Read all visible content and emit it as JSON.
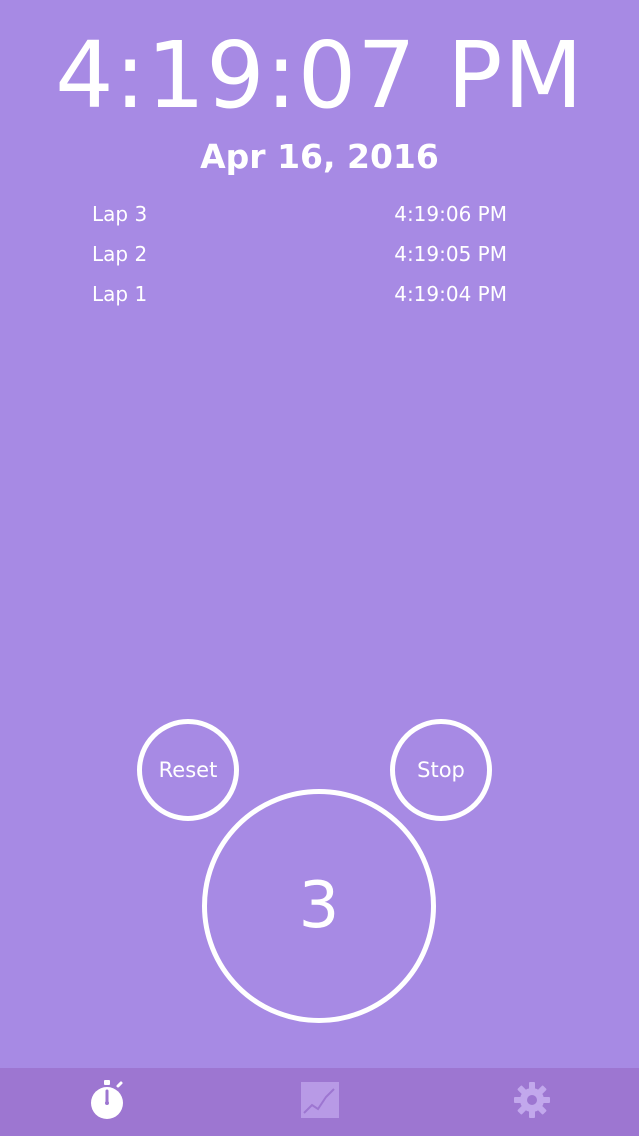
{
  "clock": {
    "time": "4:19:07 PM",
    "date": "Apr 16, 2016"
  },
  "laps": [
    {
      "label": "Lap 3",
      "time": "4:19:06 PM"
    },
    {
      "label": "Lap 2",
      "time": "4:19:05 PM"
    },
    {
      "label": "Lap 1",
      "time": "4:19:04 PM"
    }
  ],
  "controls": {
    "reset_label": "Reset",
    "stop_label": "Stop",
    "lap_count": "3"
  },
  "tabbar": {
    "tabs": [
      {
        "icon": "stopwatch-icon",
        "active": true
      },
      {
        "icon": "chart-icon",
        "active": false
      },
      {
        "icon": "gear-icon",
        "active": false
      }
    ]
  },
  "colors": {
    "background": "#a78ae4",
    "tabbar": "#9d76d1",
    "foreground": "#ffffff"
  }
}
